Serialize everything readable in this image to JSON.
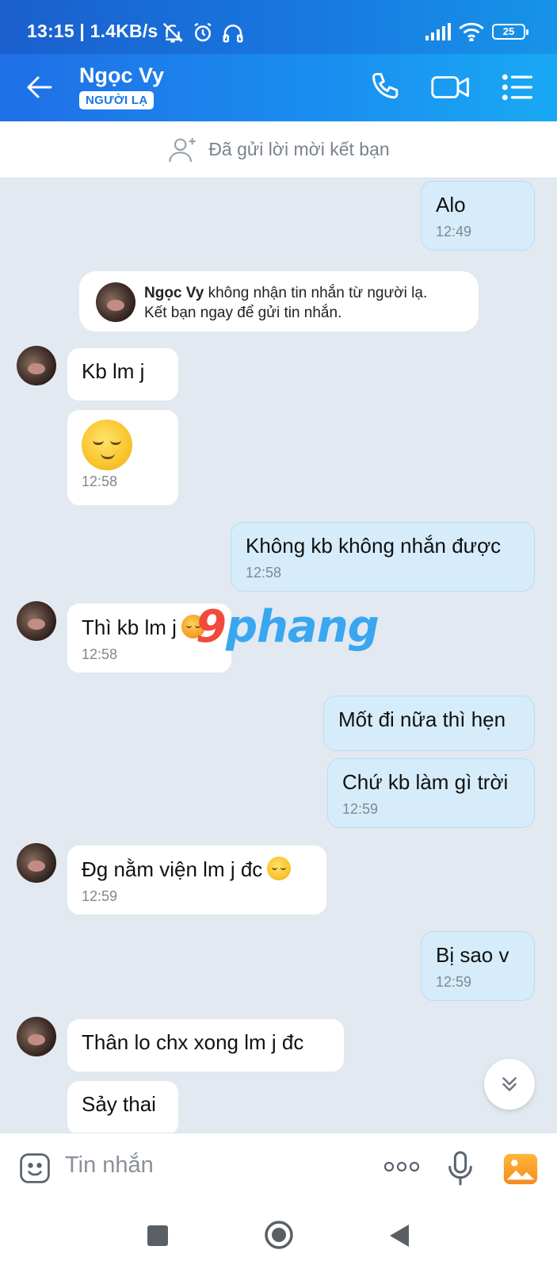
{
  "status": {
    "time": "13:15",
    "net_speed": "| 1.4KB/s",
    "battery": "25"
  },
  "header": {
    "contact_name": "Ngọc Vy",
    "badge": "NGƯỜI LẠ"
  },
  "friend_request": {
    "text": "Đã gửi lời mời kết bạn"
  },
  "system_note": {
    "name": "Ngọc Vy",
    "line1_rest": " không nhận tin nhắn từ người lạ.",
    "line2": "Kết bạn ngay để gửi tin nhắn."
  },
  "messages": [
    {
      "from": "me",
      "text": "Alo",
      "time": "12:49"
    },
    {
      "from": "them",
      "text": "Kb lm j"
    },
    {
      "from": "them",
      "emoji": "relieved-face",
      "time": "12:58"
    },
    {
      "from": "me",
      "text": "Không kb không nhắn được",
      "time": "12:58"
    },
    {
      "from": "them",
      "text": "Thì kb lm j",
      "time": "12:58"
    },
    {
      "from": "me",
      "text": "Mốt đi nữa thì hẹn"
    },
    {
      "from": "me",
      "text": "Chứ kb làm gì trời",
      "time": "12:59"
    },
    {
      "from": "them",
      "text": "Đg nằm viện lm j đc",
      "time": "12:59"
    },
    {
      "from": "me",
      "text": "Bị sao v",
      "time": "12:59"
    },
    {
      "from": "them",
      "text": "Thân lo chx xong lm j đc"
    },
    {
      "from": "them",
      "text": "Sảy thai"
    }
  ],
  "watermark": {
    "first": "9",
    "rest": "phang"
  },
  "composer": {
    "placeholder": "Tin nhắn"
  },
  "colors": {
    "header_gradient_start": "#1f6fe6",
    "header_gradient_end": "#19a9f3",
    "my_bubble": "#d6ecfb",
    "their_bubble": "#ffffff",
    "chat_background": "#e2e9f1"
  }
}
